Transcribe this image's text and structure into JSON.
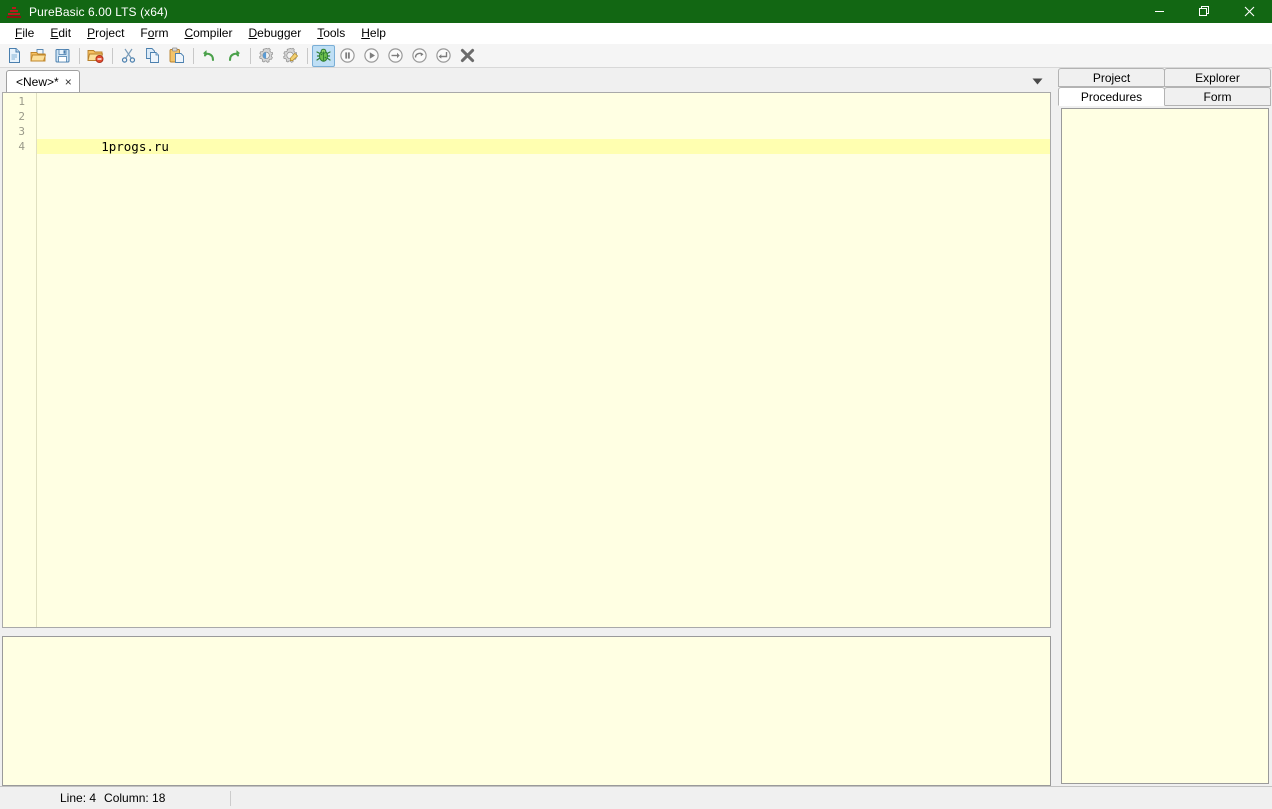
{
  "window": {
    "title": "PureBasic 6.00 LTS (x64)",
    "icon": "purebasic-logo-icon",
    "titlebar_color": "#126713",
    "controls": {
      "minimize": "minimize-icon",
      "restore": "restore-icon",
      "close": "close-icon"
    }
  },
  "menubar": {
    "items": [
      {
        "label": "File",
        "accel": "F"
      },
      {
        "label": "Edit",
        "accel": "E"
      },
      {
        "label": "Project",
        "accel": "P"
      },
      {
        "label": "Form",
        "accel": "o"
      },
      {
        "label": "Compiler",
        "accel": "C"
      },
      {
        "label": "Debugger",
        "accel": "D"
      },
      {
        "label": "Tools",
        "accel": "T"
      },
      {
        "label": "Help",
        "accel": "H"
      }
    ]
  },
  "toolbar": {
    "buttons": [
      {
        "name": "new-file-button",
        "icon": "new-file-icon",
        "tooltip": "New",
        "active": false
      },
      {
        "name": "open-file-button",
        "icon": "open-folder-icon",
        "tooltip": "Open",
        "active": false
      },
      {
        "name": "save-file-button",
        "icon": "save-disk-icon",
        "tooltip": "Save",
        "active": false
      },
      {
        "name": "separator-1",
        "icon": "separator",
        "tooltip": "",
        "active": false
      },
      {
        "name": "close-file-button",
        "icon": "close-folder-icon",
        "tooltip": "Close",
        "active": false
      },
      {
        "name": "separator-2",
        "icon": "separator",
        "tooltip": "",
        "active": false
      },
      {
        "name": "cut-button",
        "icon": "scissors-icon",
        "tooltip": "Cut",
        "active": false
      },
      {
        "name": "copy-button",
        "icon": "copy-pages-icon",
        "tooltip": "Copy",
        "active": false
      },
      {
        "name": "paste-button",
        "icon": "clipboard-icon",
        "tooltip": "Paste",
        "active": false
      },
      {
        "name": "separator-3",
        "icon": "separator",
        "tooltip": "",
        "active": false
      },
      {
        "name": "undo-button",
        "icon": "undo-arrow-icon",
        "tooltip": "Undo",
        "active": false
      },
      {
        "name": "redo-button",
        "icon": "redo-arrow-icon",
        "tooltip": "Redo",
        "active": false
      },
      {
        "name": "separator-4",
        "icon": "separator",
        "tooltip": "",
        "active": false
      },
      {
        "name": "compile-run-button",
        "icon": "gear-blue-icon",
        "tooltip": "Compile/Run",
        "active": false
      },
      {
        "name": "compiler-options-button",
        "icon": "gear-pencil-icon",
        "tooltip": "Compiler Options",
        "active": false
      },
      {
        "name": "separator-5",
        "icon": "separator",
        "tooltip": "",
        "active": false
      },
      {
        "name": "debugger-button",
        "icon": "green-bug-icon",
        "tooltip": "Debugger",
        "active": true
      },
      {
        "name": "pause-button",
        "icon": "pause-circle-icon",
        "tooltip": "Pause",
        "active": false
      },
      {
        "name": "continue-button",
        "icon": "play-circle-icon",
        "tooltip": "Continue",
        "active": false
      },
      {
        "name": "step-button",
        "icon": "step-arrow-icon",
        "tooltip": "Step",
        "active": false
      },
      {
        "name": "step-over-button",
        "icon": "step-over-icon",
        "tooltip": "Step Over",
        "active": false
      },
      {
        "name": "step-out-button",
        "icon": "step-out-icon",
        "tooltip": "Step Out",
        "active": false
      },
      {
        "name": "stop-button",
        "icon": "stop-x-icon",
        "tooltip": "Stop",
        "active": false
      }
    ]
  },
  "editor": {
    "tab": {
      "label": "<New>*",
      "close_glyph": "×"
    },
    "dropdown_glyph": "▼",
    "line_numbers": [
      "1",
      "2",
      "3",
      "4"
    ],
    "lines": [
      "",
      "",
      "",
      "        1progs.ru"
    ],
    "current_line_index": 3,
    "background_color": "#ffffe3",
    "current_line_color": "#ffffb0"
  },
  "output_panel": {
    "text": ""
  },
  "right_panel": {
    "tabs_row1": [
      {
        "label": "Project",
        "selected": false
      },
      {
        "label": "Explorer",
        "selected": false
      }
    ],
    "tabs_row2": [
      {
        "label": "Procedures",
        "selected": true
      },
      {
        "label": "Form",
        "selected": false
      }
    ],
    "list_items": []
  },
  "statusbar": {
    "line_label": "Line: 4",
    "column_label": "Column: 18",
    "message": ""
  }
}
